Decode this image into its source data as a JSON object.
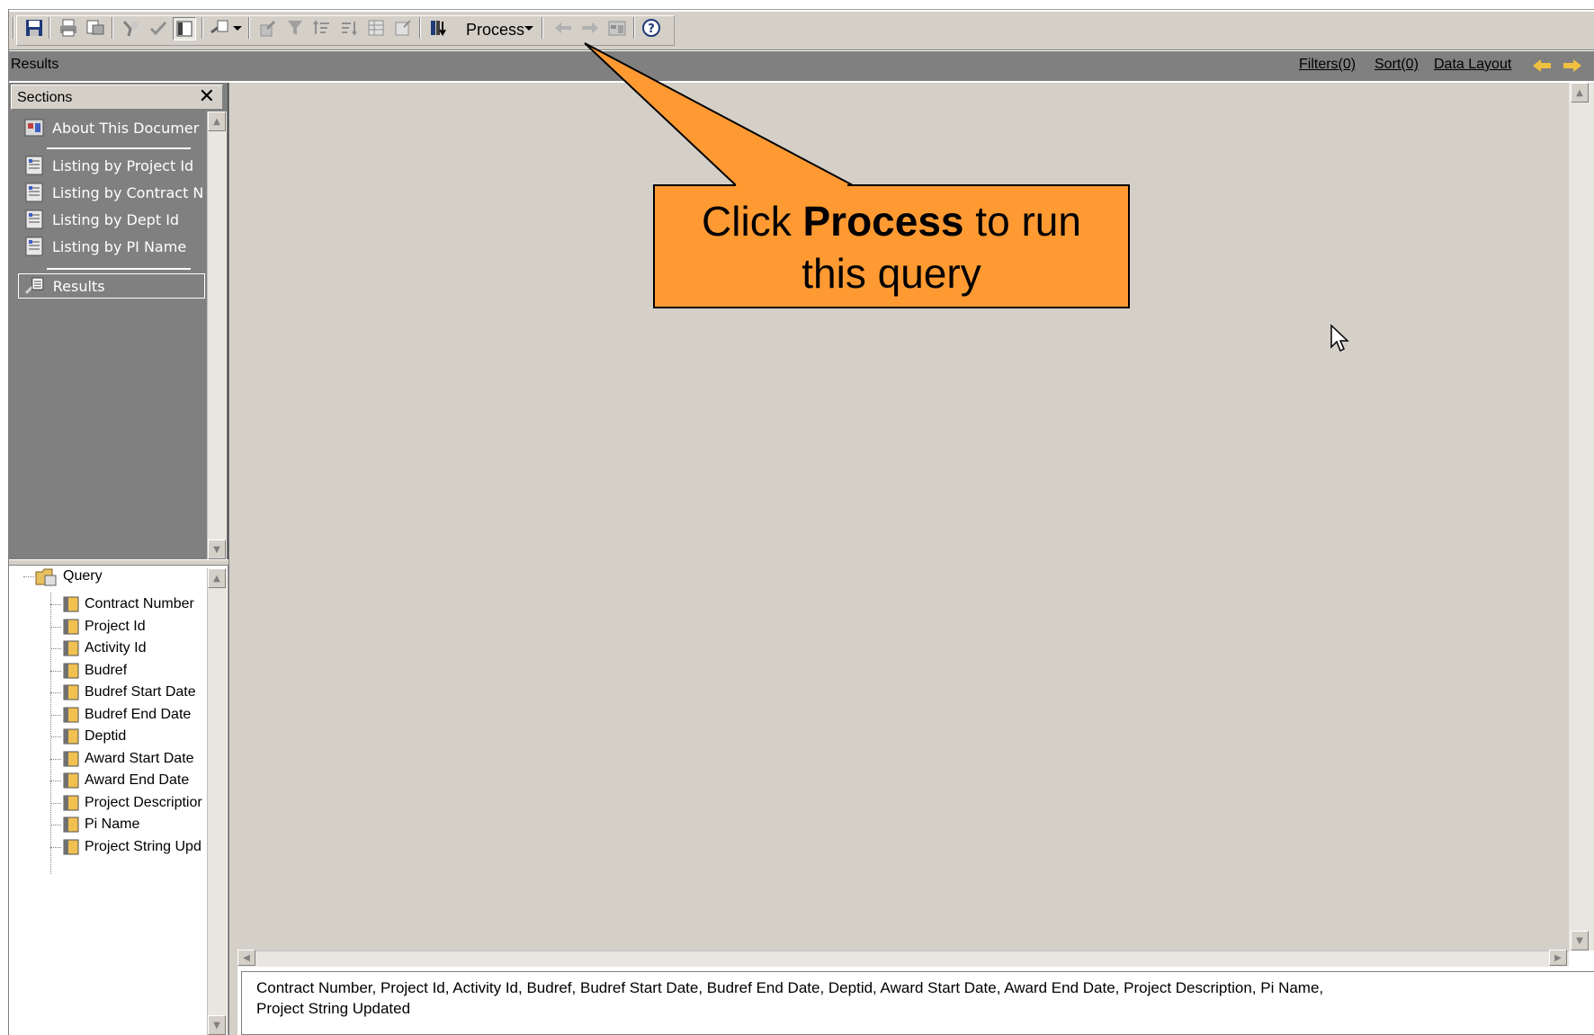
{
  "toolbar": {
    "process_label": "Process"
  },
  "results_bar": {
    "title": "Results",
    "filters_label": "Filters(0)",
    "sort_label": "Sort(0)",
    "data_layout_label": "Data Layout"
  },
  "sections": {
    "title": "Sections",
    "close_glyph": "✕",
    "items": [
      {
        "label": "About This Documer",
        "icon": "document-report-icon"
      },
      {
        "label": "Listing by Project Id",
        "icon": "report-icon"
      },
      {
        "label": "Listing by Contract N",
        "icon": "report-icon"
      },
      {
        "label": "Listing by Dept Id",
        "icon": "report-icon"
      },
      {
        "label": "Listing by PI Name",
        "icon": "report-icon"
      },
      {
        "label": "Results",
        "icon": "results-icon",
        "selected": true
      }
    ]
  },
  "query_tree": {
    "root_label": "Query",
    "columns": [
      "Contract Number",
      "Project Id",
      "Activity Id",
      "Budref",
      "Budref Start Date",
      "Budref End Date",
      "Deptid",
      "Award Start Date",
      "Award End Date",
      "Project Descriptior",
      "Pi Name",
      "Project String Upd"
    ]
  },
  "column_list": {
    "line1": "Contract Number, Project Id, Activity Id, Budref, Budref Start Date, Budref End Date, Deptid, Award Start Date, Award End Date, Project Description, Pi Name,",
    "line2": "Project String Updated"
  },
  "callout": {
    "prefix": "Click ",
    "bold": "Process",
    "suffix": " to run",
    "line2": "this query",
    "color": "#ff9a33"
  },
  "colors": {
    "panel_gray": "#808080",
    "face_gray": "#d4d0c8",
    "callout_orange": "#ff9a33"
  }
}
